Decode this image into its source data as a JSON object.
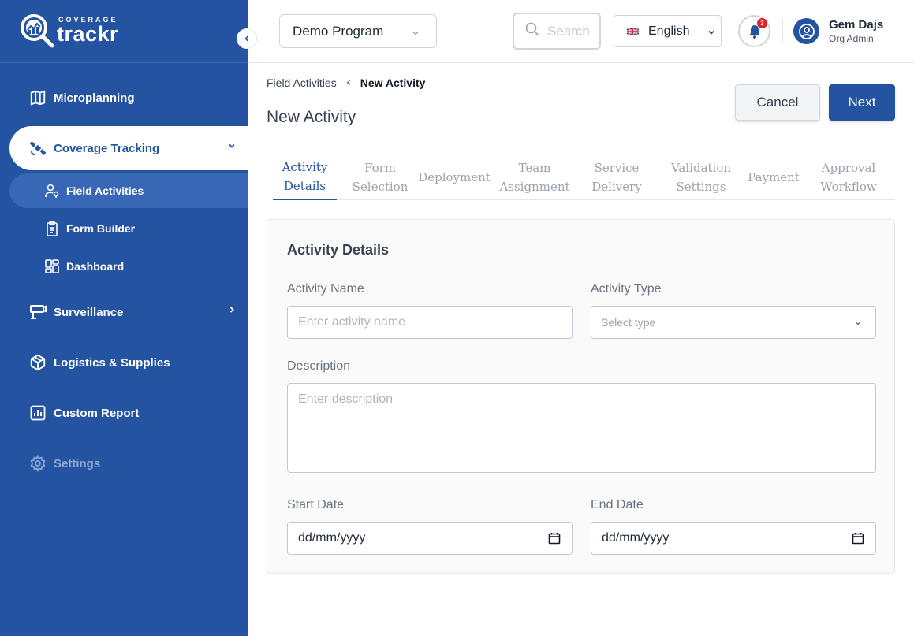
{
  "brand": {
    "small": "COVERAGE",
    "big": "trackr"
  },
  "sidebar": {
    "items": [
      {
        "label": "Microplanning",
        "icon": "map-icon"
      },
      {
        "label": "Coverage Tracking",
        "icon": "satellite-icon",
        "active": true
      },
      {
        "label": "Surveillance",
        "icon": "surveillance-icon"
      },
      {
        "label": "Logistics & Supplies",
        "icon": "package-icon"
      },
      {
        "label": "Custom Report",
        "icon": "chart-icon"
      },
      {
        "label": "Settings",
        "icon": "gear-icon",
        "disabled": true
      }
    ],
    "subitems": [
      {
        "label": "Field Activities",
        "icon": "user-location-icon",
        "active": true
      },
      {
        "label": "Form Builder",
        "icon": "clipboard-icon"
      },
      {
        "label": "Dashboard",
        "icon": "dashboard-icon"
      }
    ]
  },
  "header": {
    "program": "Demo Program",
    "search_placeholder": "Search",
    "language": "English",
    "notification_count": "3",
    "user_name": "Gem Dajs",
    "user_role": "Org Admin"
  },
  "breadcrumb": {
    "parent": "Field Activities",
    "current": "New Activity"
  },
  "page": {
    "title": "New Activity",
    "cancel_label": "Cancel",
    "next_label": "Next"
  },
  "tabs": [
    {
      "label": "Activity\nDetails",
      "active": true
    },
    {
      "label": "Form\nSelection"
    },
    {
      "label": "Deployment"
    },
    {
      "label": "Team\nAssignment"
    },
    {
      "label": "Service\nDelivery"
    },
    {
      "label": "Validation\nSettings"
    },
    {
      "label": "Payment"
    },
    {
      "label": "Approval\nWorkflow"
    }
  ],
  "form": {
    "section_title": "Activity Details",
    "activity_name_label": "Activity Name",
    "activity_name_placeholder": "Enter activity name",
    "activity_type_label": "Activity Type",
    "activity_type_placeholder": "Select type",
    "description_label": "Description",
    "description_placeholder": "Enter description",
    "start_date_label": "Start Date",
    "start_date_value": "dd/mm/yyyy",
    "end_date_label": "End Date",
    "end_date_value": "dd/mm/yyyy"
  },
  "colors": {
    "primary": "#2453a1",
    "sidebar_active_sub": "#3867b6",
    "badge": "#dc2626"
  }
}
